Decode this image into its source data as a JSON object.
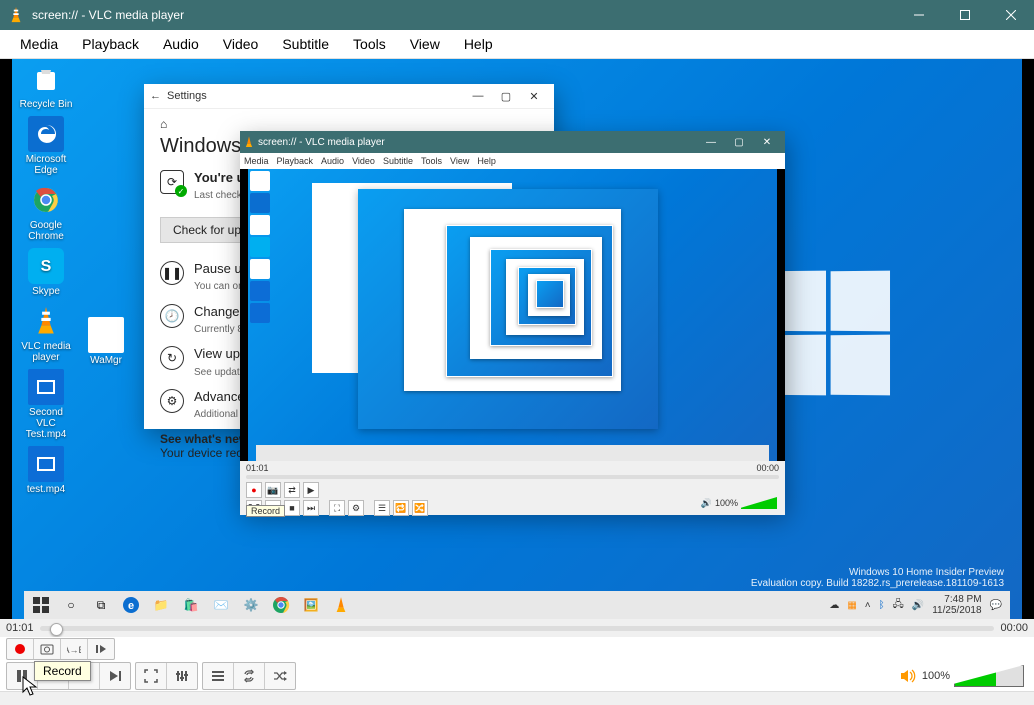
{
  "titlebar": {
    "title": "screen:// - VLC media player"
  },
  "menu": {
    "media": "Media",
    "playback": "Playback",
    "audio": "Audio",
    "video": "Video",
    "subtitle": "Subtitle",
    "tools": "Tools",
    "view": "View",
    "help": "Help"
  },
  "desktop_icons": [
    "Recycle Bin",
    "Microsoft Edge",
    "Google Chrome",
    "Skype",
    "VLC media player",
    "Second VLC Test.mp4",
    "test.mp4"
  ],
  "desktop_icon_wamgr": "WaMgr",
  "settings": {
    "app_title": "Settings",
    "heading": "Windows Update",
    "uptodate": "You're up to date",
    "lastcheck": "Last checked:",
    "check_button": "Check for updates",
    "pause_title": "Pause updates",
    "pause_sub": "You can only pause updates",
    "hours_title": "Change active hours",
    "hours_sub": "Currently 8:00",
    "history_title": "View update history",
    "history_sub": "See updates installed",
    "advanced_title": "Advanced options",
    "advanced_sub": "Additional update settings",
    "whatsnew_title": "See what's new",
    "whatsnew_sub": "Your device recently got the latest improvements."
  },
  "nested": {
    "title": "screen:// - VLC media player",
    "time_l": "01:01",
    "time_r": "00:00",
    "rec_label": "Record",
    "vol": "100%"
  },
  "watermark": {
    "l1": "Windows 10 Home Insider Preview",
    "l2": "Evaluation copy. Build 18282.rs_prerelease.181109-1613"
  },
  "tray": {
    "time": "7:48 PM",
    "date": "11/25/2018"
  },
  "seek": {
    "left": "01:01",
    "right": "00:00"
  },
  "tooltip": "Record",
  "volume": {
    "label": "100%"
  }
}
